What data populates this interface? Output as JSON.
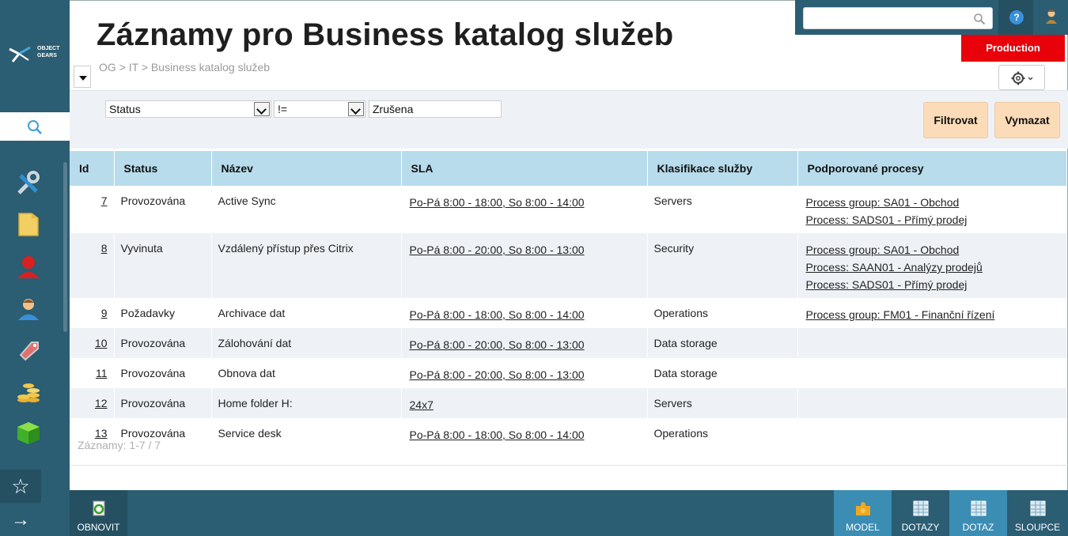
{
  "logo": {
    "line1": "OBJECT",
    "line2": "GEARS"
  },
  "header": {
    "title": "Záznamy pro Business katalog služeb",
    "breadcrumb": "OG > IT > Business katalog služeb"
  },
  "topbar": {
    "search_placeholder": "",
    "help_label": "?",
    "environment": "Production"
  },
  "sidebar": {
    "icons": [
      "tools-icon",
      "folder-icon",
      "user-red-icon",
      "user-icon",
      "tag-icon",
      "coins-icon",
      "cube-icon"
    ],
    "star": "☆",
    "arrow": "→"
  },
  "filter": {
    "field": "Status",
    "operator": "!=",
    "value": "Zrušena",
    "apply_label": "Filtrovat",
    "clear_label": "Vymazat"
  },
  "table": {
    "columns": [
      "Id",
      "Status",
      "Název",
      "SLA",
      "Klasifikace služby",
      "Podporované procesy"
    ],
    "rows": [
      {
        "id": "7",
        "status": "Provozována",
        "name": "Active Sync",
        "sla": "Po-Pá 8:00 - 18:00, So 8:00 - 14:00",
        "class": "Servers",
        "processes": [
          "Process group: SA01 - Obchod ",
          "Process: SADS01 - Přímý prodej "
        ]
      },
      {
        "id": "8",
        "status": "Vyvinuta",
        "name": "Vzdálený přístup přes Citrix",
        "sla": "Po-Pá 8:00 - 20:00, So 8:00 - 13:00",
        "class": "Security",
        "processes": [
          "Process group: SA01 - Obchod ",
          "Process: SAAN01 - Analýzy prodejů",
          "Process: SADS01 - Přímý prodej "
        ]
      },
      {
        "id": "9",
        "status": "Požadavky",
        "name": "Archivace dat",
        "sla": "Po-Pá 8:00 - 18:00, So 8:00 - 14:00",
        "class": "Operations",
        "processes": [
          "Process group: FM01 - Finanční řízení "
        ]
      },
      {
        "id": "10",
        "status": "Provozována",
        "name": "Zálohování dat",
        "sla": "Po-Pá 8:00 - 20:00, So 8:00 - 13:00",
        "class": "Data storage",
        "processes": []
      },
      {
        "id": "11",
        "status": "Provozována",
        "name": "Obnova dat",
        "sla": "Po-Pá 8:00 - 20:00, So 8:00 - 13:00",
        "class": "Data storage",
        "processes": []
      },
      {
        "id": "12",
        "status": "Provozována",
        "name": "Home folder H:",
        "sla": "24x7",
        "class": "Servers",
        "processes": []
      },
      {
        "id": "13",
        "status": "Provozována",
        "name": "Service desk",
        "sla": "Po-Pá 8:00 - 18:00, So 8:00 - 14:00",
        "class": "Operations",
        "processes": []
      }
    ],
    "records_label": "Záznamy: 1-7 / 7"
  },
  "bottombar": {
    "refresh": "OBNOVIT",
    "model": "MODEL",
    "queries": "DOTAZY",
    "query": "DOTAZ",
    "columns": "SLOUPCE"
  }
}
